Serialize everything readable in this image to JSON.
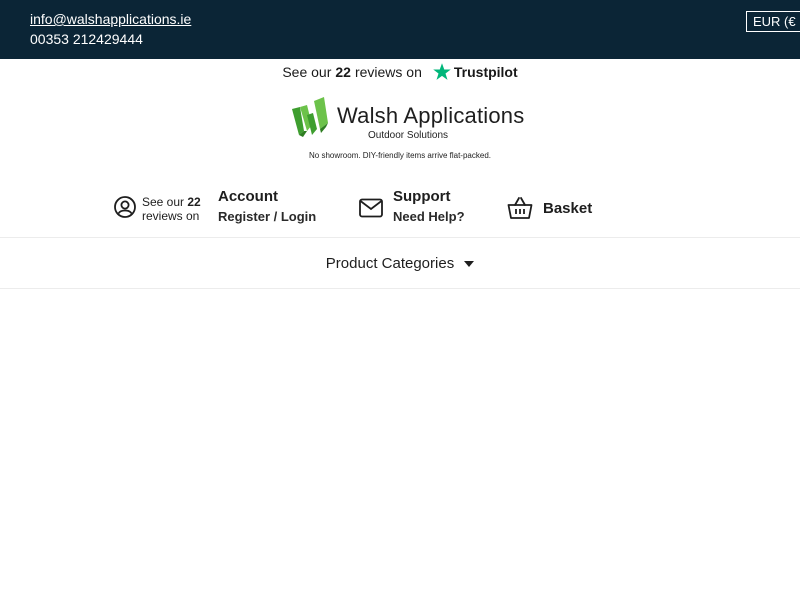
{
  "topbar": {
    "email": "info@walshapplications.ie",
    "phone": "00353 212429444",
    "currency": "EUR (€"
  },
  "trustpilot": {
    "prefix": "See our",
    "count": "22",
    "suffix": "reviews on",
    "brand": "Trustpilot",
    "star_color": "#00b67a"
  },
  "brand": {
    "name": "Walsh Applications",
    "tagline": "Outdoor Solutions",
    "notice": "No showroom. DIY-friendly items arrive flat-packed.",
    "logo_colors": [
      "#2e8b2e",
      "#6cc24a"
    ]
  },
  "mini_trust": {
    "prefix": "See our",
    "count": "22",
    "suffix": "reviews on"
  },
  "nav": {
    "account": {
      "title": "Account",
      "sub": "Register / Login",
      "icon": "user-circle-icon"
    },
    "support": {
      "title": "Support",
      "sub": "Need Help?",
      "icon": "envelope-icon"
    },
    "basket": {
      "title": "Basket",
      "icon": "basket-icon"
    }
  },
  "menu": {
    "categories_label": "Product Categories",
    "icon": "caret-down-icon"
  },
  "colors": {
    "topbar_bg": "#0b2536",
    "text": "#1e1e1e"
  }
}
